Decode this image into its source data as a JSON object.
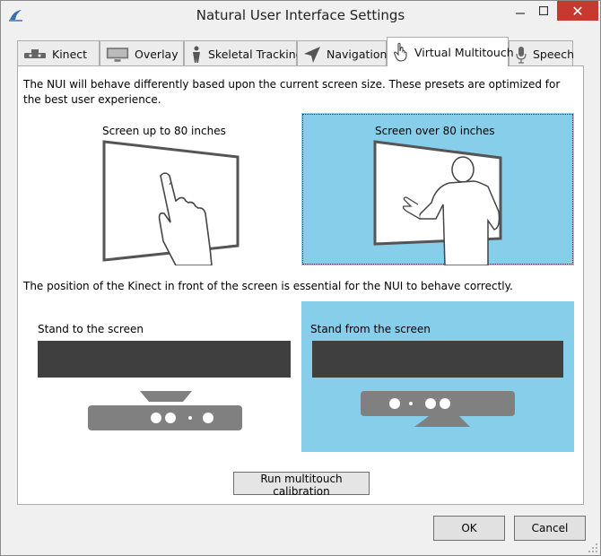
{
  "window": {
    "title": "Natural User Interface Settings",
    "close_glyph": "✕"
  },
  "tabs": [
    {
      "label": "Kinect",
      "icon": "kinect-icon"
    },
    {
      "label": "Overlay",
      "icon": "monitor-icon"
    },
    {
      "label": "Skeletal Tracking",
      "icon": "person-icon"
    },
    {
      "label": "Navigation",
      "icon": "cursor-arrow-icon"
    },
    {
      "label": "Virtual Multitouch",
      "icon": "hand-pointer-icon",
      "active": true
    },
    {
      "label": "Speech",
      "icon": "microphone-icon"
    }
  ],
  "content": {
    "intro": "The NUI will behave differently based upon the current screen size. These presets are optimized for the best user experience.",
    "small_screen_label": "Screen up to 80 inches",
    "large_screen_label": "Screen over 80 inches",
    "position_text": "The position of the Kinect in front of the screen is essential for the NUI to behave correctly.",
    "stand_to_label": "Stand to the screen",
    "stand_from_label": "Stand from the screen",
    "selected_screen_preset": "Screen over 80 inches",
    "selected_position_preset": "Stand from the screen"
  },
  "buttons": {
    "calibrate": "Run multitouch calibration",
    "ok": "OK",
    "cancel": "Cancel"
  },
  "colors": {
    "selected_bg": "#87ceeb",
    "dark_bar": "#3f3f3f",
    "sensor": "#808080",
    "close_red": "#c7382e"
  }
}
